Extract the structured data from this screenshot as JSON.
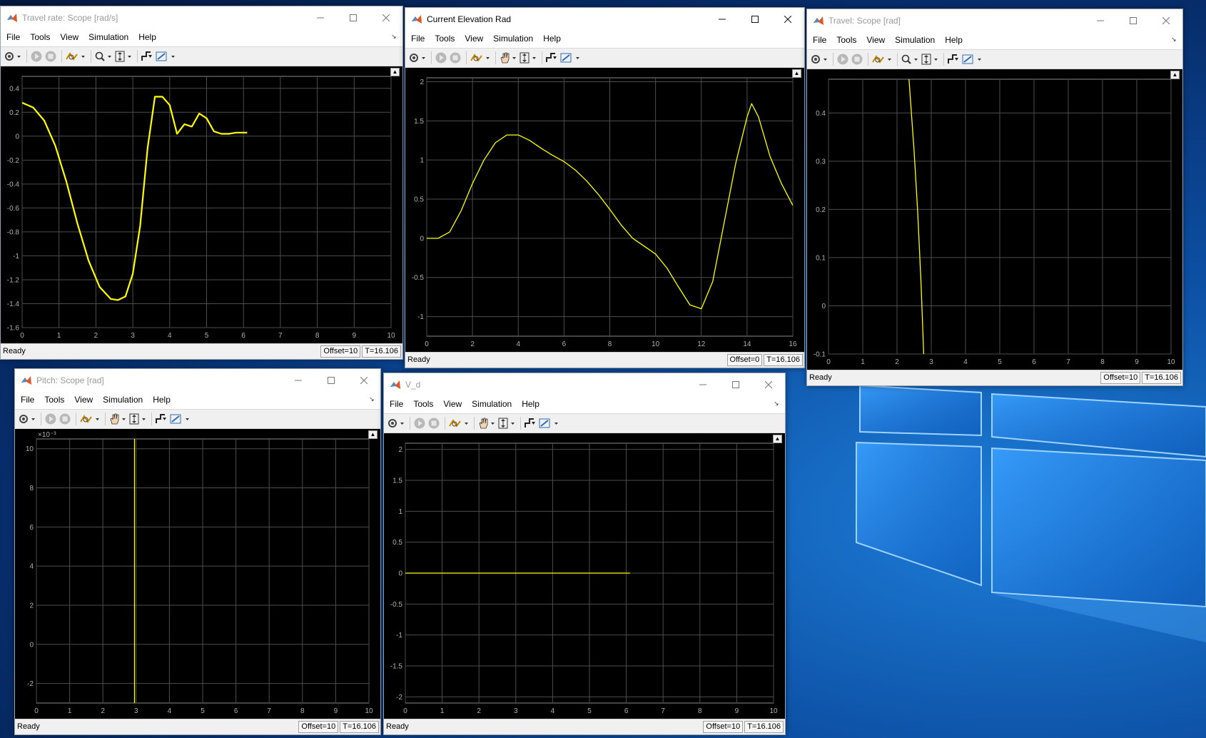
{
  "menu": [
    "File",
    "Tools",
    "View",
    "Simulation",
    "Help"
  ],
  "status_text": "Ready",
  "windows": [
    {
      "title": "Travel rate: Scope [rad/s]",
      "offset": "Offset=10",
      "time": "T=16.106",
      "chart_data": {
        "type": "line",
        "xlim": [
          0,
          10
        ],
        "ylim": [
          -1.6,
          0.5
        ],
        "xticks": [
          0,
          1,
          2,
          3,
          4,
          5,
          6,
          7,
          8,
          9,
          10
        ],
        "yticks": [
          -1.6,
          -1.4,
          -1.2,
          -1,
          -0.8,
          -0.6,
          -0.4,
          -0.2,
          0,
          0.2,
          0.4
        ],
        "ytick_labels": [
          "-1.6",
          "-1.4",
          "-1.2",
          "-1",
          "-0.8",
          "-0.6",
          "-0.4",
          "-0.2",
          "0",
          "0.2",
          "0.4"
        ],
        "exponent": "",
        "grid": true,
        "series": [
          {
            "color": "#ffff00",
            "x": [
              0,
              0.3,
              0.6,
              0.9,
              1.2,
              1.5,
              1.8,
              2.1,
              2.4,
              2.6,
              2.8,
              3.0,
              3.2,
              3.4,
              3.6,
              3.8,
              4.0,
              4.2,
              4.4,
              4.6,
              4.8,
              5.0,
              5.2,
              5.4,
              5.6,
              5.8,
              6.0,
              6.1
            ],
            "y": [
              0.28,
              0.24,
              0.13,
              -0.08,
              -0.38,
              -0.73,
              -1.04,
              -1.26,
              -1.36,
              -1.37,
              -1.34,
              -1.15,
              -0.75,
              -0.1,
              0.33,
              0.33,
              0.26,
              0.02,
              0.1,
              0.08,
              0.19,
              0.15,
              0.04,
              0.02,
              0.02,
              0.03,
              0.03,
              0.03
            ]
          }
        ]
      }
    },
    {
      "title": "Current Elevation Rad",
      "offset": "Offset=0",
      "time": "T=16.106",
      "chart_data": {
        "type": "line",
        "xlim": [
          0,
          16
        ],
        "ylim": [
          -1.25,
          2.05
        ],
        "xticks": [
          0,
          2,
          4,
          6,
          8,
          10,
          12,
          14,
          16
        ],
        "yticks": [
          -1,
          -0.5,
          0,
          0.5,
          1,
          1.5,
          2
        ],
        "ytick_labels": [
          "-1",
          "-0.5",
          "0",
          "0.5",
          "1",
          "1.5",
          "2"
        ],
        "exponent": "",
        "grid": true,
        "series": [
          {
            "color": "#ffff00",
            "x": [
              0,
              0.5,
              1.0,
              1.5,
              2.0,
              2.5,
              3.0,
              3.5,
              4.0,
              4.5,
              5.0,
              5.5,
              6.0,
              6.5,
              7.0,
              7.5,
              8.0,
              8.5,
              9.0,
              9.5,
              10.0,
              10.5,
              11.0,
              11.5,
              12.0,
              12.5,
              13.0,
              13.5,
              14.0,
              14.2,
              14.5,
              15.0,
              15.5,
              16.0
            ],
            "y": [
              0,
              0,
              0.08,
              0.35,
              0.7,
              1.0,
              1.22,
              1.32,
              1.32,
              1.25,
              1.15,
              1.06,
              0.98,
              0.87,
              0.73,
              0.56,
              0.37,
              0.17,
              0.0,
              -0.1,
              -0.2,
              -0.38,
              -0.62,
              -0.85,
              -0.9,
              -0.55,
              0.2,
              0.95,
              1.55,
              1.72,
              1.55,
              1.05,
              0.7,
              0.42
            ]
          }
        ]
      }
    },
    {
      "title": "Travel: Scope [rad]",
      "offset": "Offset=10",
      "time": "T=16.106",
      "chart_data": {
        "type": "line",
        "xlim": [
          0,
          10
        ],
        "ylim": [
          -0.1,
          0.47
        ],
        "xticks": [
          0,
          1,
          2,
          3,
          4,
          5,
          6,
          7,
          8,
          9,
          10
        ],
        "yticks": [
          -0.1,
          0,
          0.1,
          0.2,
          0.3,
          0.4
        ],
        "ytick_labels": [
          "-0.1",
          "0",
          "0.1",
          "0.2",
          "0.3",
          "0.4"
        ],
        "exponent": "",
        "grid": true,
        "series": [
          {
            "color": "#ffff00",
            "x": [
              2.35,
              2.5,
              2.6,
              2.7,
              2.78
            ],
            "y": [
              0.47,
              0.32,
              0.2,
              0.05,
              -0.1
            ]
          }
        ]
      }
    },
    {
      "title": "Pitch: Scope [rad]",
      "offset": "Offset=10",
      "time": "T=16.106",
      "chart_data": {
        "type": "line",
        "xlim": [
          0,
          10
        ],
        "ylim": [
          -3,
          10.5
        ],
        "xticks": [
          0,
          1,
          2,
          3,
          4,
          5,
          6,
          7,
          8,
          9,
          10
        ],
        "yticks": [
          -2,
          0,
          2,
          4,
          6,
          8,
          10
        ],
        "ytick_labels": [
          "-2",
          "0",
          "2",
          "4",
          "6",
          "8",
          "10"
        ],
        "exponent": "×10⁻³",
        "grid": true,
        "series": [
          {
            "color": "#ffff00",
            "x": [
              2.95,
              2.95
            ],
            "y": [
              -3,
              10.5
            ]
          }
        ]
      }
    },
    {
      "title": "V_d",
      "offset": "Offset=10",
      "time": "T=16.106",
      "chart_data": {
        "type": "line",
        "xlim": [
          0,
          10
        ],
        "ylim": [
          -2.1,
          2.1
        ],
        "xticks": [
          0,
          1,
          2,
          3,
          4,
          5,
          6,
          7,
          8,
          9,
          10
        ],
        "yticks": [
          -2,
          -1.5,
          -1,
          -0.5,
          0,
          0.5,
          1,
          1.5,
          2
        ],
        "ytick_labels": [
          "-2",
          "-1.5",
          "-1",
          "-0.5",
          "0",
          "0.5",
          "1",
          "1.5",
          "2"
        ],
        "exponent": "",
        "grid": true,
        "series": [
          {
            "color": "#ffff00",
            "x": [
              0,
              6.1
            ],
            "y": [
              0,
              0
            ]
          }
        ]
      }
    }
  ]
}
